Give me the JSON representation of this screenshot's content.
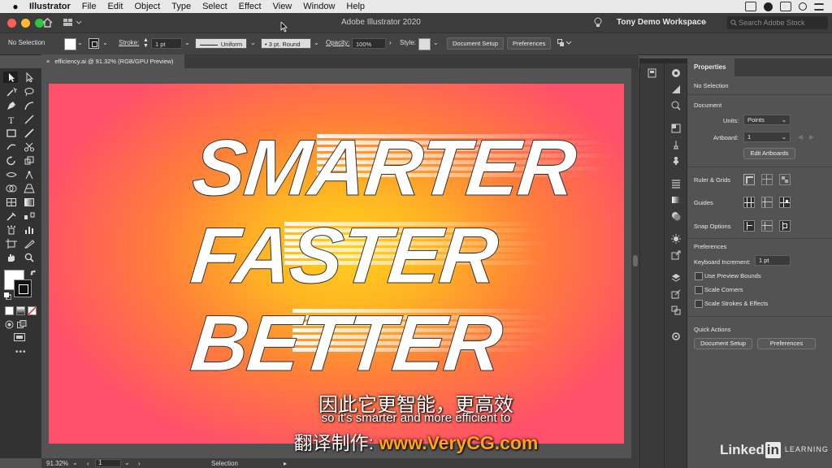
{
  "mac_menu": {
    "items": [
      "Illustrator",
      "File",
      "Edit",
      "Object",
      "Type",
      "Select",
      "Effect",
      "View",
      "Window",
      "Help"
    ]
  },
  "appbar": {
    "title": "Adobe Illustrator 2020",
    "workspace": "Tony Demo Workspace",
    "search_placeholder": "Search Adobe Stock"
  },
  "control": {
    "selection": "No Selection",
    "stroke_label": "Stroke:",
    "stroke_value": "1 pt",
    "profile": "Uniform",
    "brush": "3 pt. Round",
    "opacity_label": "Opacity:",
    "opacity_value": "100%",
    "style_label": "Style:",
    "document_setup": "Document Setup",
    "preferences": "Preferences"
  },
  "document": {
    "tab": "efficiency.ai @ 91.32% (RGB/GPU Preview)",
    "words": [
      "SMARTER",
      "FASTER",
      "BETTER"
    ]
  },
  "status": {
    "zoom": "91.32%",
    "artboard": "1",
    "tool": "Selection"
  },
  "properties": {
    "tab": "Properties",
    "no_selection": "No Selection",
    "document": "Document",
    "units_label": "Units:",
    "units_value": "Points",
    "artboard_label": "Artboard:",
    "artboard_value": "1",
    "edit_artboards": "Edit Artboards",
    "rulers_grids": "Ruler & Grids",
    "guides": "Guides",
    "snap_options": "Snap Options",
    "preferences": "Preferences",
    "keyboard_increment_label": "Keyboard Increment:",
    "keyboard_increment_value": "1 pt",
    "use_preview_bounds": "Use Preview Bounds",
    "scale_corners": "Scale Corners",
    "scale_strokes": "Scale Strokes & Effects",
    "quick_actions": "Quick Actions",
    "document_setup_btn": "Document Setup",
    "preferences_btn": "Preferences"
  },
  "subtitles": {
    "zh": "因此它更智能，更高效",
    "en": "so it's smarter and more efficient to",
    "credit_zh": "翻译制作:",
    "credit_url": "www.VeryCG.com"
  },
  "watermark": {
    "linked": "Linked",
    "in": "in",
    "learning": "LEARNING"
  },
  "colors": {
    "gradient_center": "#ffd21c",
    "gradient_edge": "#ff4f6a",
    "credit_url": "#ffa31a"
  }
}
